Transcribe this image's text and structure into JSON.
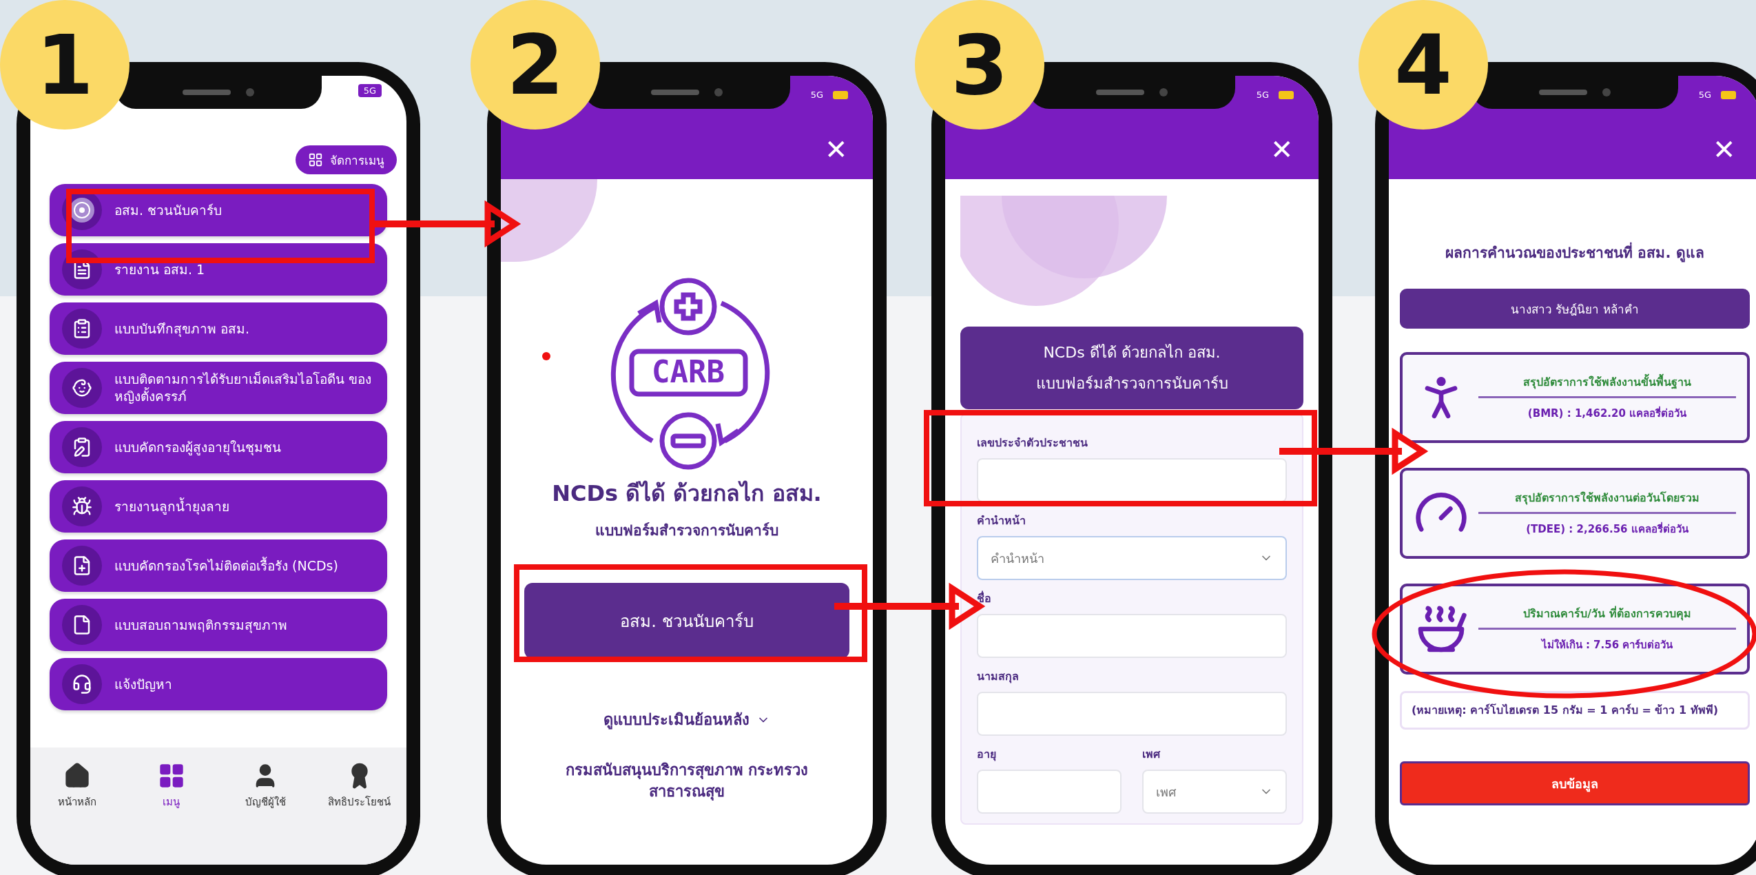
{
  "steps": [
    {
      "number": "1",
      "kind": "menu",
      "status": "5G",
      "manage_button": "จัดการเมนู",
      "menu_items": [
        "อสม. ชวนนับคาร์บ",
        "รายงาน อสม. 1",
        "แบบบันทึกสุขภาพ อสม.",
        "แบบติดตามการได้รับยาเม็ดเสริมไอโอดีน ของหญิงตั้งครรภ์",
        "แบบคัดกรองผู้สูงอายุในชุมชน",
        "รายงานลูกน้ำยุงลาย",
        "แบบคัดกรองโรคไม่ติดต่อเรื้อรัง (NCDs)",
        "แบบสอบถามพฤติกรรมสุขภาพ",
        "แจ้งปัญหา"
      ],
      "bottom_nav": [
        {
          "label": "หน้าหลัก",
          "selected": false
        },
        {
          "label": "เมนู",
          "selected": true
        },
        {
          "label": "บัญชีผู้ใช้",
          "selected": false
        },
        {
          "label": "สิทธิประโยชน์",
          "selected": false
        }
      ]
    },
    {
      "number": "2",
      "kind": "intro",
      "status": "5G",
      "close": "✕",
      "icon_text": "CARB",
      "title": "NCDs ดีได้ ด้วยกลไก อสม.",
      "subtitle": "แบบฟอร์มสำรวจการนับคาร์บ",
      "start_button": "อสม. ชวนนับคาร์บ",
      "history_link": "ดูแบบประเมินย้อนหลัง",
      "footer": "กรมสนับสนุนบริการสุขภาพ กระทรวงสาธารณสุข"
    },
    {
      "number": "3",
      "kind": "form",
      "status": "5G",
      "close": "✕",
      "header": [
        "NCDs ดีได้ ด้วยกลไก อสม.",
        "แบบฟอร์มสำรวจการนับคาร์บ"
      ],
      "fields": [
        {
          "label": "เลขประจำตัวประชาชน",
          "kind": "text"
        },
        {
          "label": "คำนำหน้า",
          "kind": "select",
          "placeholder": "คำนำหน้า"
        },
        {
          "label": "ชื่อ",
          "kind": "text"
        },
        {
          "label": "นามสกุล",
          "kind": "text"
        }
      ],
      "pair_fields": [
        {
          "label": "อายุ",
          "kind": "text"
        },
        {
          "label": "เพศ",
          "kind": "select",
          "placeholder": "เพศ"
        }
      ]
    },
    {
      "number": "4",
      "kind": "result",
      "status": "5G",
      "close": "✕",
      "title": "ผลการคำนวณของประชาชนที่ อสม. ดูแล",
      "person": "นางสาว รัษฎ์นิยา หล้าคำ",
      "cards": [
        {
          "title": "สรุปอัตราการใช้พลังงานขั้นพื้นฐาน",
          "value": "(BMR) : 1,462.20 แคลอรี่ต่อวัน"
        },
        {
          "title": "สรุปอัตราการใช้พลังงานต่อวันโดยรวม",
          "value": "(TDEE) : 2,266.56 แคลอรี่ต่อวัน"
        },
        {
          "title": "ปริมาณคาร์บ/วัน ที่ต้องการควบคุม",
          "value": "ไม่ให้เกิน : 7.56 คาร์บต่อวัน"
        }
      ],
      "note": "(หมายเหตุ: คาร์โบไฮเดรต 15 กรัม = 1 คาร์บ = ข้าว 1 ทัพพี)",
      "delete_button": "ลบข้อมูล"
    }
  ]
}
